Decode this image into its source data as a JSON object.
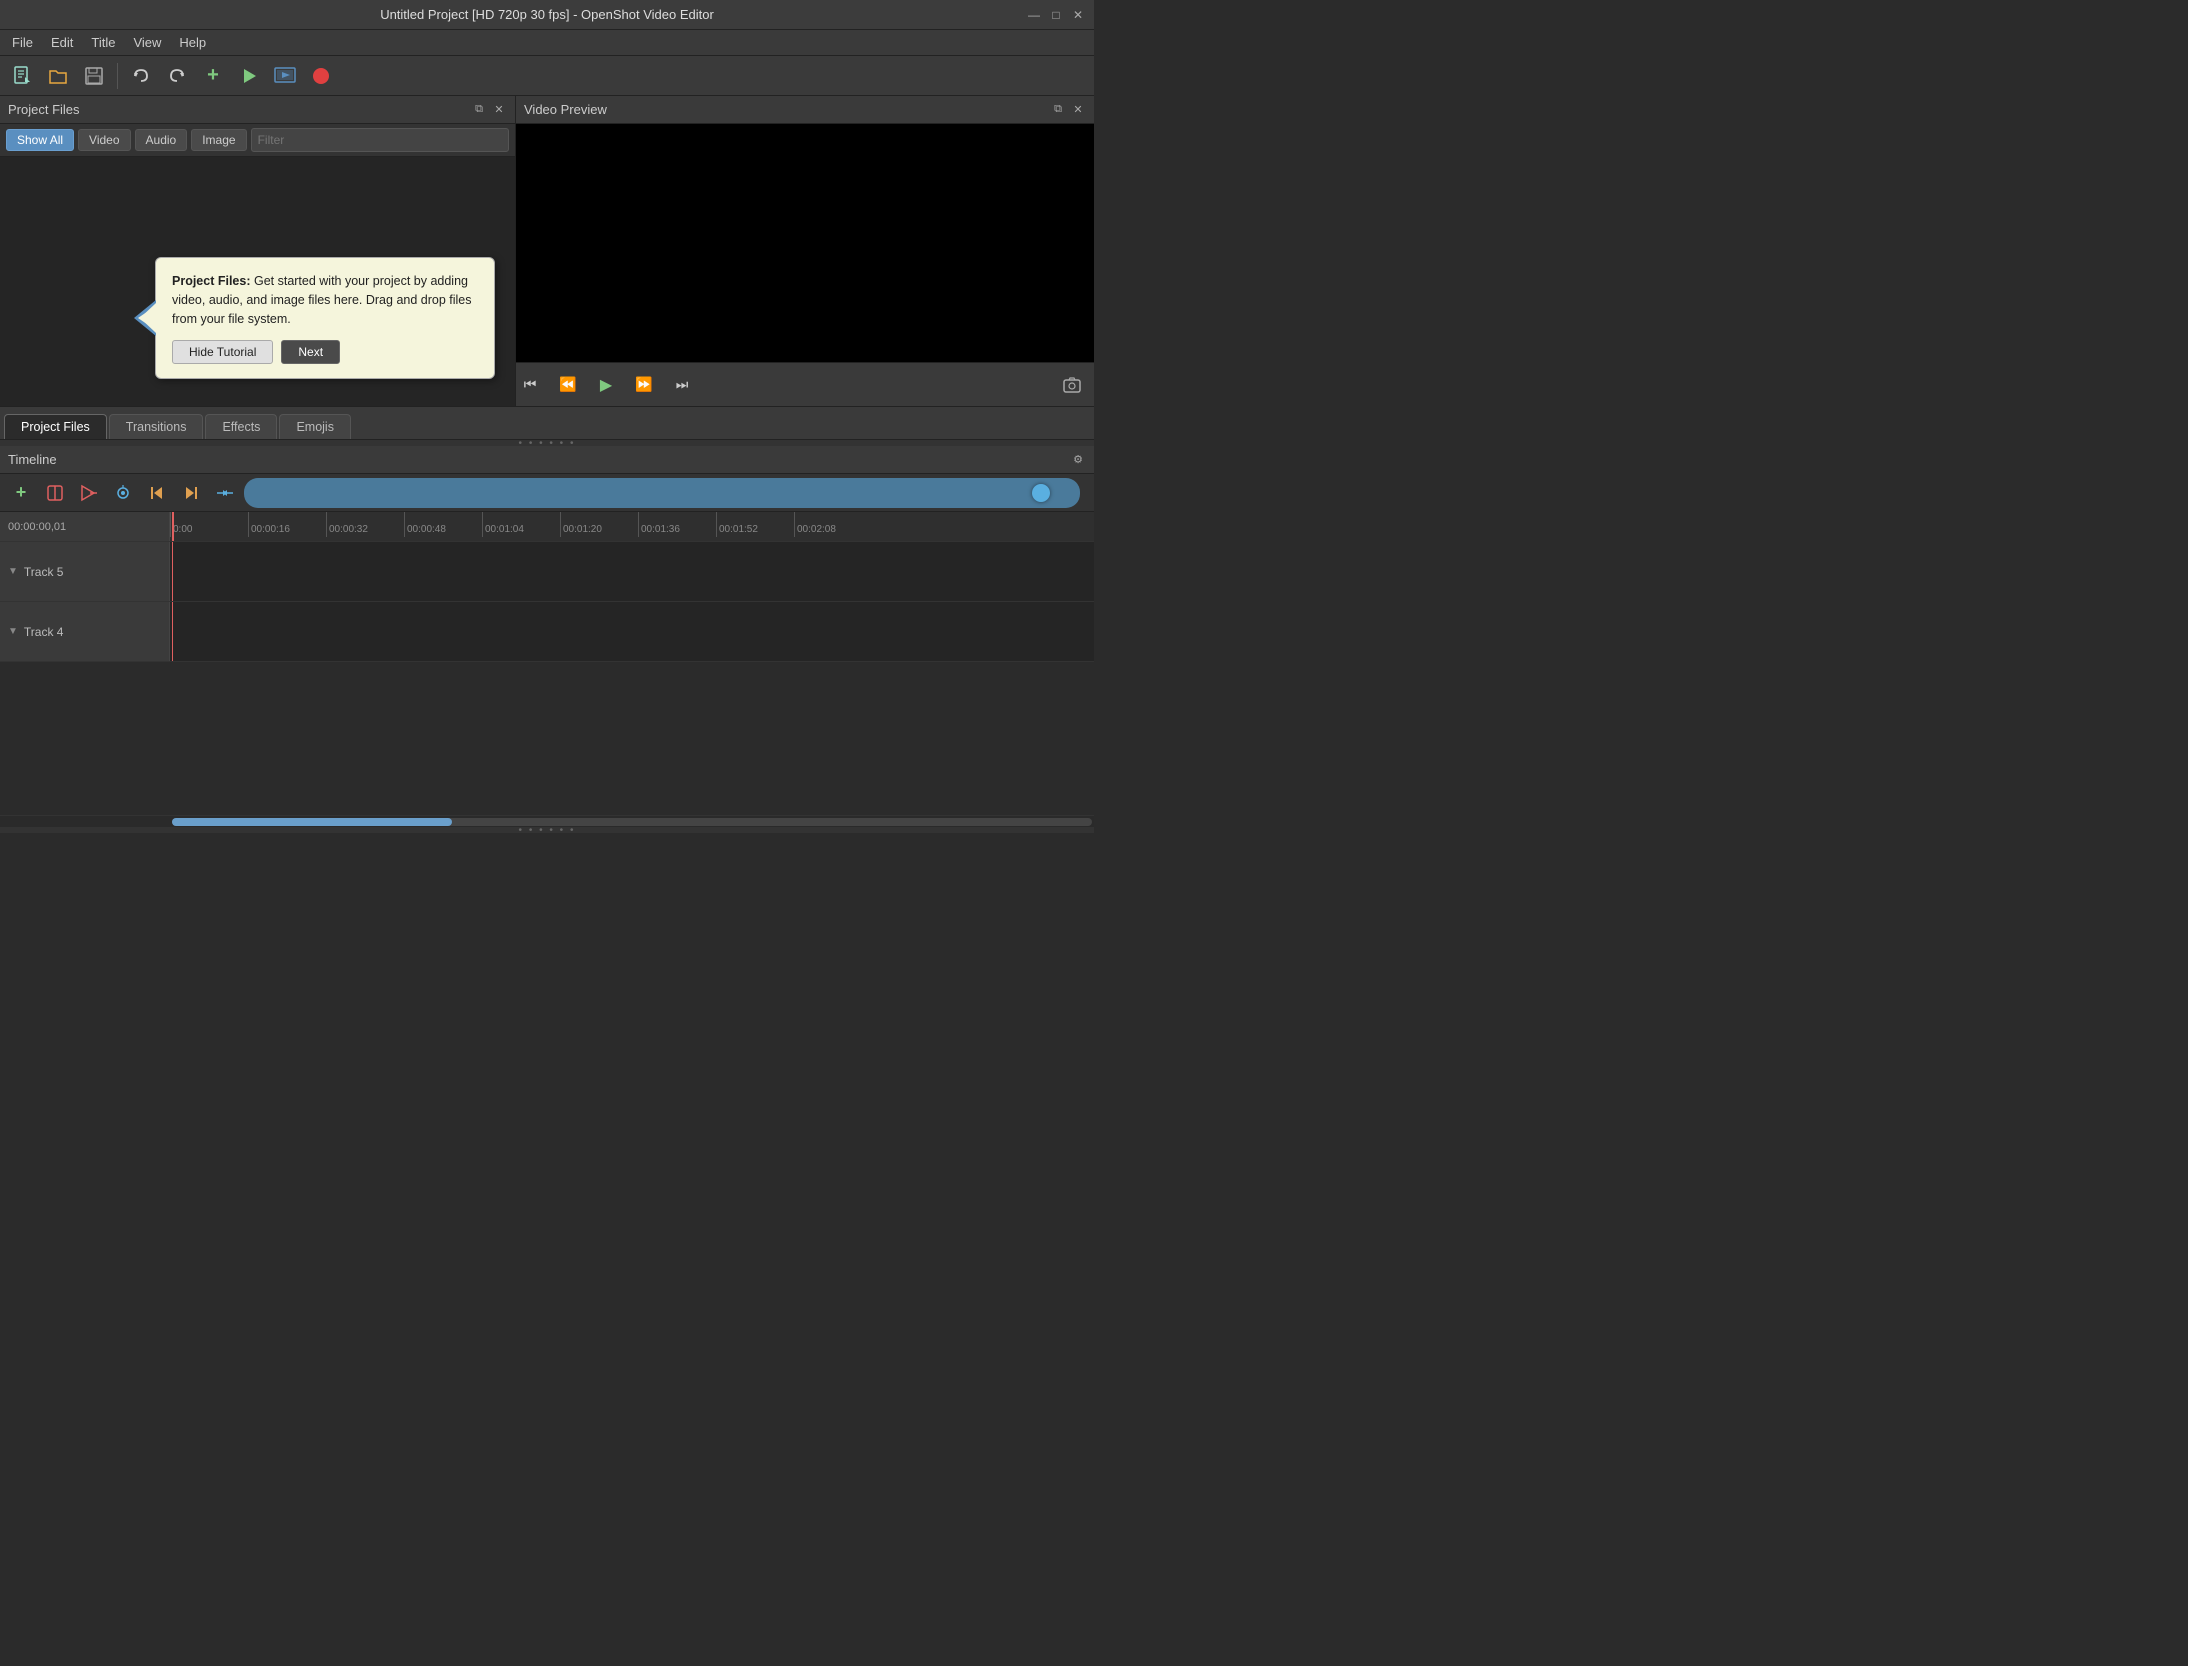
{
  "titlebar": {
    "title": "Untitled Project [HD 720p 30 fps] - OpenShot Video Editor",
    "min_btn": "—",
    "max_btn": "□",
    "close_btn": "✕"
  },
  "menubar": {
    "items": [
      {
        "label": "File"
      },
      {
        "label": "Edit"
      },
      {
        "label": "Title"
      },
      {
        "label": "View"
      },
      {
        "label": "Help"
      }
    ]
  },
  "toolbar": {
    "new_icon": "📄",
    "open_icon": "📂",
    "save_icon": "💾",
    "undo_icon": "↩",
    "redo_icon": "↪",
    "add_icon": "+",
    "preview_icon": "▶",
    "export_icon": "🎬",
    "record_icon": "⏺"
  },
  "project_files_panel": {
    "title": "Project Files",
    "filter_buttons": [
      {
        "label": "Show All",
        "active": true
      },
      {
        "label": "Video",
        "active": false
      },
      {
        "label": "Audio",
        "active": false
      },
      {
        "label": "Image",
        "active": false
      }
    ],
    "filter_placeholder": "Filter"
  },
  "tooltip": {
    "title": "Project Files:",
    "body": " Get started with your project by adding video, audio, and image files here. Drag and drop files from your file system.",
    "hide_btn": "Hide Tutorial",
    "next_btn": "Next"
  },
  "video_preview": {
    "title": "Video Preview"
  },
  "video_controls": {
    "skip_start": "⏮",
    "rewind": "⏪",
    "play": "▶",
    "fast_forward": "⏩",
    "skip_end": "⏭",
    "screenshot": "📷"
  },
  "bottom_tabs": {
    "tabs": [
      {
        "label": "Project Files",
        "active": true
      },
      {
        "label": "Transitions",
        "active": false
      },
      {
        "label": "Effects",
        "active": false
      },
      {
        "label": "Emojis",
        "active": false
      }
    ]
  },
  "timeline": {
    "title": "Timeline",
    "toolbar_btns": [
      {
        "icon": "+",
        "color": "green",
        "name": "add-track"
      },
      {
        "icon": "🧲",
        "color": "red",
        "name": "snap-tool"
      },
      {
        "icon": "✂",
        "color": "red",
        "name": "razor-tool"
      },
      {
        "icon": "💧",
        "color": "blue",
        "name": "add-transition"
      },
      {
        "icon": "|◀",
        "color": "orange",
        "name": "jump-start"
      },
      {
        "icon": "▶|",
        "color": "orange",
        "name": "jump-end"
      },
      {
        "icon": "↔",
        "color": "blue",
        "name": "center-timeline"
      }
    ],
    "current_time": "00:00:00,01",
    "ruler_marks": [
      "0:00",
      "00:00:16",
      "00:00:32",
      "00:00:48",
      "00:01:04",
      "00:01:20",
      "00:01:36",
      "00:01:52",
      "00:02:08"
    ],
    "tracks": [
      {
        "name": "Track 5"
      },
      {
        "name": "Track 4"
      }
    ]
  }
}
